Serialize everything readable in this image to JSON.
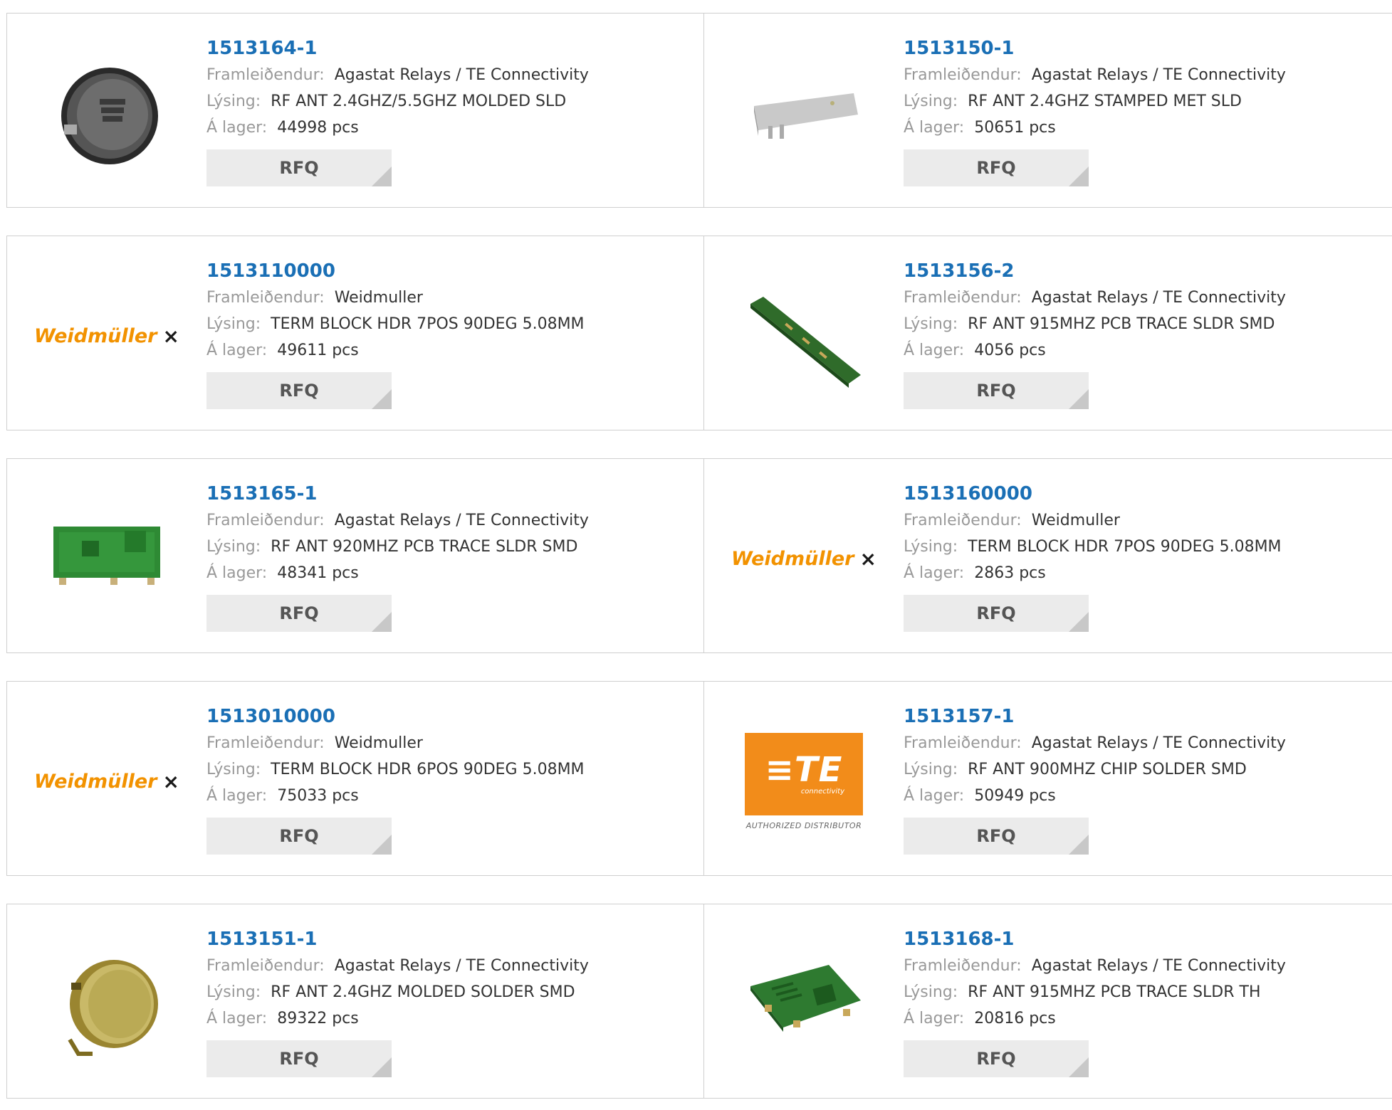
{
  "labels": {
    "manufacturer": "Framleiðendur:",
    "description": "Lýsing:",
    "stock": "Á lager:",
    "rfq": "RFQ"
  },
  "brand": {
    "weidmuller_logo_text": "Weidmüller",
    "te_logo_text": "TE",
    "te_logo_sub": "connectivity",
    "te_authorized": "AUTHORIZED DISTRIBUTOR"
  },
  "colors": {
    "part_number": "#1a6fb5",
    "weidmuller_orange": "#f29200",
    "te_orange": "#f28c1a",
    "rfq_bg": "#ebebeb"
  },
  "products": [
    {
      "part": "1513164-1",
      "manufacturer": "Agastat Relays / TE Connectivity",
      "description": "RF ANT 2.4GHZ/5.5GHZ MOLDED SLD",
      "stock": "44998 pcs",
      "image": "round-antenna-black"
    },
    {
      "part": "1513150-1",
      "manufacturer": "Agastat Relays / TE Connectivity",
      "description": "RF ANT 2.4GHZ STAMPED MET SLD",
      "stock": "50651 pcs",
      "image": "stamped-metal-antenna"
    },
    {
      "part": "1513110000",
      "manufacturer": "Weidmuller",
      "description": "TERM BLOCK HDR 7POS 90DEG 5.08MM",
      "stock": "49611 pcs",
      "image": "weidmuller-logo"
    },
    {
      "part": "1513156-2",
      "manufacturer": "Agastat Relays / TE Connectivity",
      "description": "RF ANT 915MHZ PCB TRACE SLDR SMD",
      "stock": "4056 pcs",
      "image": "pcb-strip-antenna"
    },
    {
      "part": "1513165-1",
      "manufacturer": "Agastat Relays / TE Connectivity",
      "description": "RF ANT 920MHZ PCB TRACE SLDR SMD",
      "stock": "48341 pcs",
      "image": "pcb-board-antenna"
    },
    {
      "part": "1513160000",
      "manufacturer": "Weidmuller",
      "description": "TERM BLOCK HDR 7POS 90DEG 5.08MM",
      "stock": "2863 pcs",
      "image": "weidmuller-logo"
    },
    {
      "part": "1513010000",
      "manufacturer": "Weidmuller",
      "description": "TERM BLOCK HDR 6POS 90DEG 5.08MM",
      "stock": "75033 pcs",
      "image": "weidmuller-logo"
    },
    {
      "part": "1513157-1",
      "manufacturer": "Agastat Relays / TE Connectivity",
      "description": "RF ANT 900MHZ CHIP SOLDER SMD",
      "stock": "50949 pcs",
      "image": "te-logo"
    },
    {
      "part": "1513151-1",
      "manufacturer": "Agastat Relays / TE Connectivity",
      "description": "RF ANT 2.4GHZ MOLDED SOLDER SMD",
      "stock": "89322 pcs",
      "image": "round-antenna-gold"
    },
    {
      "part": "1513168-1",
      "manufacturer": "Agastat Relays / TE Connectivity",
      "description": "RF ANT 915MHZ PCB TRACE SLDR TH",
      "stock": "20816 pcs",
      "image": "pcb-board-antenna-th"
    }
  ]
}
